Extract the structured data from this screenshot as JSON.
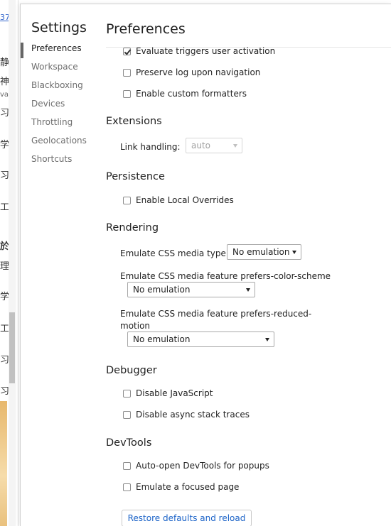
{
  "background_page": {
    "link_text": "37",
    "glyphs": [
      "静",
      "神",
      "va",
      "习",
      "学",
      "习",
      "工",
      "於",
      "理",
      "学",
      "工",
      "习",
      "习"
    ]
  },
  "sidebar": {
    "title": "Settings",
    "items": [
      {
        "label": "Preferences",
        "active": true
      },
      {
        "label": "Workspace"
      },
      {
        "label": "Blackboxing"
      },
      {
        "label": "Devices"
      },
      {
        "label": "Throttling"
      },
      {
        "label": "Geolocations"
      },
      {
        "label": "Shortcuts"
      }
    ]
  },
  "main": {
    "page_title": "Preferences",
    "checkboxes_top": [
      {
        "label": "Evaluate triggers user activation",
        "checked": true
      },
      {
        "label": "Preserve log upon navigation",
        "checked": false
      },
      {
        "label": "Enable custom formatters",
        "checked": false
      }
    ],
    "extensions": {
      "title": "Extensions",
      "link_handling_label": "Link handling:",
      "link_handling_value": "auto"
    },
    "persistence": {
      "title": "Persistence",
      "enable_local_overrides": {
        "label": "Enable Local Overrides",
        "checked": false
      }
    },
    "rendering": {
      "title": "Rendering",
      "media_type_label": "Emulate CSS media type",
      "media_type_value": "No emulation",
      "color_scheme_label": "Emulate CSS media feature prefers-color-scheme",
      "color_scheme_value": "No emulation",
      "reduced_motion_label_1": "Emulate CSS media feature prefers-reduced-",
      "reduced_motion_label_2": "motion",
      "reduced_motion_value": "No emulation"
    },
    "debugger": {
      "title": "Debugger",
      "disable_js": {
        "label": "Disable JavaScript",
        "checked": false
      },
      "disable_async": {
        "label": "Disable async stack traces",
        "checked": false
      }
    },
    "devtools": {
      "title": "DevTools",
      "auto_open": {
        "label": "Auto-open DevTools for popups",
        "checked": false
      },
      "emulate_focused": {
        "label": "Emulate a focused page",
        "checked": false
      }
    },
    "restore_button": "Restore defaults and reload"
  }
}
